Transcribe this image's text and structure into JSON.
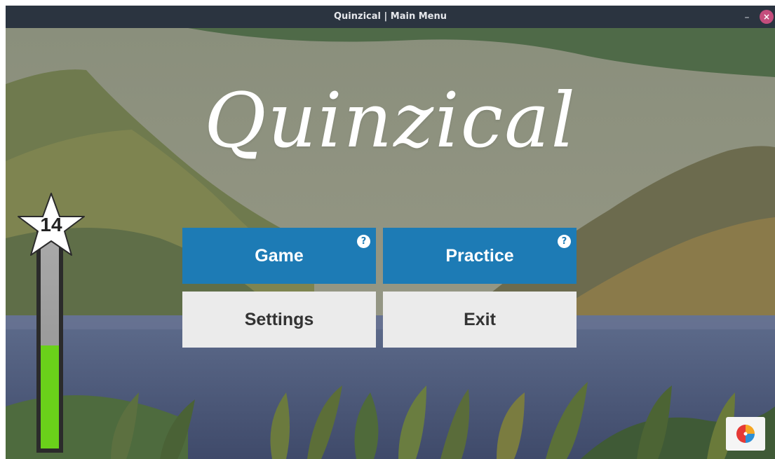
{
  "window": {
    "title": "Quinzical | Main Menu",
    "minimize_glyph": "–",
    "close_glyph": "×"
  },
  "app": {
    "logo": "Quinzical"
  },
  "menu": {
    "game_label": "Game",
    "practice_label": "Practice",
    "settings_label": "Settings",
    "exit_label": "Exit",
    "help_glyph": "?"
  },
  "progress": {
    "level": "14",
    "fill_fraction": 0.47,
    "fill_color": "#6ad11a"
  },
  "icons": {
    "help": "question-circle-icon",
    "stats": "pie-chart-icon",
    "level": "star-icon"
  },
  "colors": {
    "primary": "#1d7bb5",
    "secondary": "#ebebeb",
    "close_button": "#c44d7c"
  }
}
